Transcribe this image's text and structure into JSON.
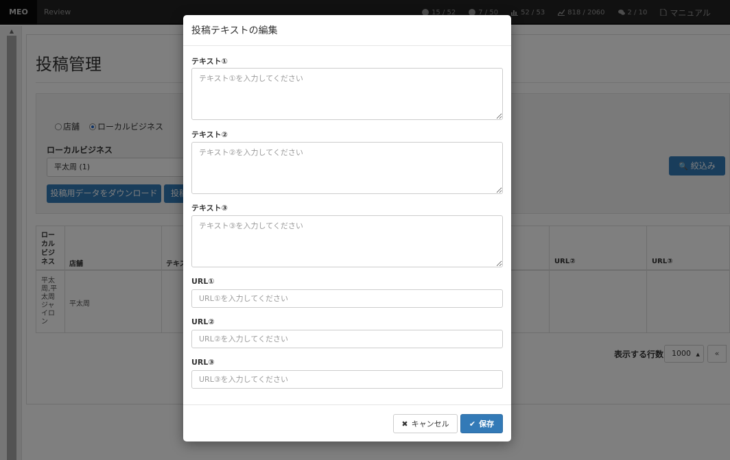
{
  "nav": {
    "brand": "MEO",
    "review": "Review",
    "stats": [
      {
        "icon": "globe-icon",
        "value": "15 / 52"
      },
      {
        "icon": "globe-icon",
        "value": "7 / 50"
      },
      {
        "icon": "bar-chart-icon",
        "value": "52 / 53"
      },
      {
        "icon": "line-chart-icon",
        "value": "818 / 2060"
      },
      {
        "icon": "comments-icon",
        "value": "2 / 10"
      }
    ],
    "manual": "マニュアル"
  },
  "page": {
    "title": "投稿管理",
    "radio_store": "店舗",
    "radio_local": "ローカルビジネス",
    "local_business_label": "ローカルビジネス",
    "local_business_value": "平太周 (1)",
    "download_button": "投稿用データをダウンロード",
    "second_button": "投稿",
    "filter_button": "絞込み",
    "table": {
      "headers": [
        "ロー\nカル\nビジ\nネス",
        "店舗",
        "テキス",
        "URL②",
        "URL③"
      ],
      "row": {
        "local_business": "平太\n周,平\n太周\nジャ\nイロ\nン",
        "store": "平太周"
      }
    },
    "rows_label": "表示する行数",
    "rows_value": "1000",
    "pager_prev": "«"
  },
  "modal": {
    "title": "投稿テキストの編集",
    "text1_label": "テキスト①",
    "text1_placeholder": "テキスト①を入力してください",
    "text2_label": "テキスト②",
    "text2_placeholder": "テキスト②を入力してください",
    "text3_label": "テキスト③",
    "text3_placeholder": "テキスト③を入力してください",
    "url1_label": "URL①",
    "url1_placeholder": "URL①を入力してください",
    "url2_label": "URL②",
    "url2_placeholder": "URL②を入力してください",
    "url3_label": "URL③",
    "url3_placeholder": "URL③を入力してください",
    "cancel_button": "キャンセル",
    "save_button": "保存"
  },
  "colors": {
    "primary": "#337ab7",
    "navbar": "#222222",
    "backdrop": "rgba(0,0,0,0.5)"
  }
}
